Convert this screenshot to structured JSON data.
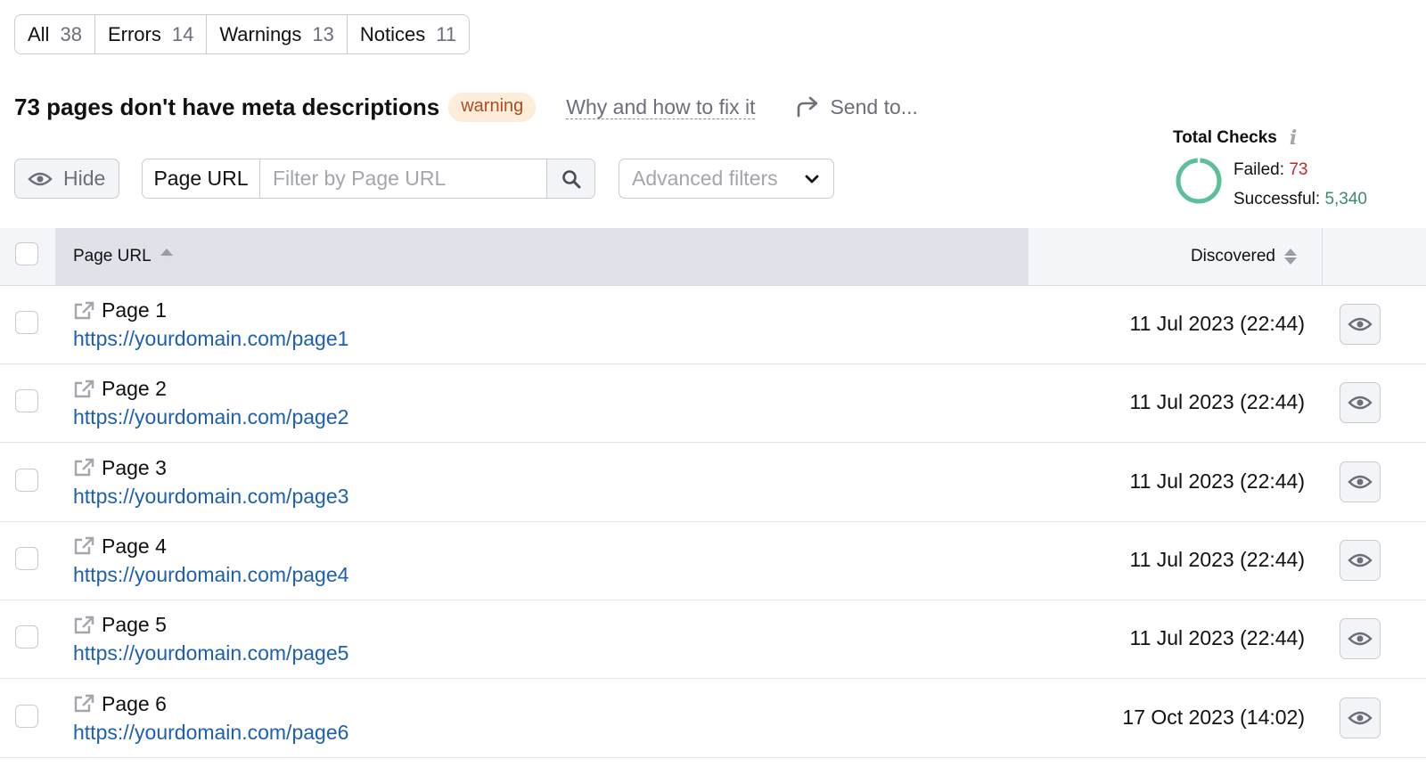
{
  "tabs": [
    {
      "label": "All",
      "count": "38"
    },
    {
      "label": "Errors",
      "count": "14"
    },
    {
      "label": "Warnings",
      "count": "13"
    },
    {
      "label": "Notices",
      "count": "11"
    }
  ],
  "issue": {
    "title": "73 pages don't have meta descriptions",
    "severity_badge": "warning",
    "why_link": "Why and how to fix it",
    "send_to": "Send to..."
  },
  "total_checks": {
    "title": "Total Checks",
    "info_icon": "i",
    "failed_label": "Failed:",
    "failed_value": "73",
    "successful_label": "Successful:",
    "successful_value": "5,340",
    "colors": {
      "failed": "#c1272d",
      "successful": "#3a8a6e",
      "ring": "#5bbf98"
    }
  },
  "filters": {
    "hide_label": "Hide",
    "search_field_label": "Page URL",
    "search_placeholder": "Filter by Page URL",
    "search_value": "",
    "advanced_filters_label": "Advanced filters"
  },
  "table": {
    "columns": {
      "page_url": "Page URL",
      "discovered": "Discovered"
    },
    "rows": [
      {
        "name": "Page 1",
        "url": "https://yourdomain.com/page1",
        "discovered": "11 Jul 2023 (22:44)"
      },
      {
        "name": "Page 2",
        "url": "https://yourdomain.com/page2",
        "discovered": "11 Jul 2023 (22:44)"
      },
      {
        "name": "Page 3",
        "url": "https://yourdomain.com/page3",
        "discovered": "11 Jul 2023 (22:44)"
      },
      {
        "name": "Page 4",
        "url": "https://yourdomain.com/page4",
        "discovered": "11 Jul 2023 (22:44)"
      },
      {
        "name": "Page 5",
        "url": "https://yourdomain.com/page5",
        "discovered": "11 Jul 2023 (22:44)"
      },
      {
        "name": "Page 6",
        "url": "https://yourdomain.com/page6",
        "discovered": "17 Oct 2023 (14:02)"
      }
    ]
  }
}
